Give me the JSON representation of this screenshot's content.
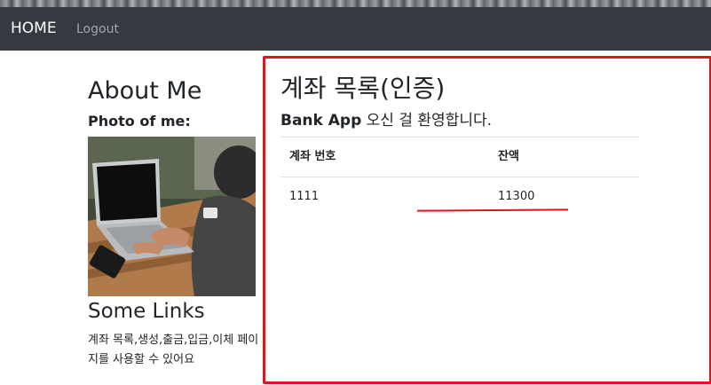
{
  "navbar": {
    "brand": "HOME",
    "logout": "Logout"
  },
  "sidebar": {
    "title": "About Me",
    "photo_label": "Photo of me:",
    "links_title": "Some Links",
    "links_text": "계좌 목록,생성,출금,입금,이체 페이지를 사용할 수 있어요"
  },
  "main": {
    "title": "계좌 목록(인증)",
    "welcome_bold": "Bank App",
    "welcome_rest": " 오신 걸 환영합니다.",
    "table": {
      "headers": [
        "계좌 번호",
        "잔액"
      ],
      "rows": [
        [
          "1111",
          "11300"
        ]
      ]
    }
  },
  "annotation_color": "#e0141b"
}
